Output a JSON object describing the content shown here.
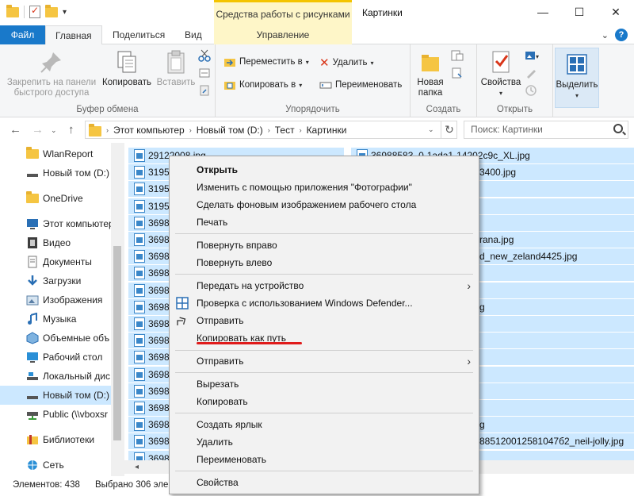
{
  "window": {
    "title": "Картинки",
    "contextual_tab_title": "Средства работы с рисунками",
    "minimize": "—",
    "maximize": "☐",
    "close": "✕"
  },
  "ribbon_tabs": {
    "file": "Файл",
    "home": "Главная",
    "share": "Поделиться",
    "view": "Вид",
    "manage": "Управление"
  },
  "ribbon": {
    "clipboard": {
      "label": "Буфер обмена",
      "pin": "Закрепить на панели быстрого доступа",
      "copy": "Копировать",
      "paste": "Вставить"
    },
    "organize": {
      "label": "Упорядочить",
      "move_to": "Переместить в",
      "copy_to": "Копировать в",
      "delete": "Удалить",
      "rename": "Переименовать"
    },
    "create": {
      "label": "Создать",
      "new_folder": "Новая папка"
    },
    "open": {
      "label": "Открыть",
      "properties": "Свойства"
    },
    "select": {
      "label": "Выделить"
    }
  },
  "address": {
    "crumbs": [
      "Этот компьютер",
      "Новый том (D:)",
      "Тест",
      "Картинки"
    ],
    "search_placeholder": "Поиск: Картинки"
  },
  "nav": {
    "items": [
      {
        "label": "WlanReport",
        "icon": "folder-icon"
      },
      {
        "label": "Новый том (D:)",
        "icon": "drive-icon"
      },
      {
        "label": "OneDrive",
        "icon": "onedrive-folder-icon"
      },
      {
        "label": "Этот компьютер",
        "icon": "computer-icon"
      },
      {
        "label": "Видео",
        "icon": "video-icon"
      },
      {
        "label": "Документы",
        "icon": "documents-icon"
      },
      {
        "label": "Загрузки",
        "icon": "downloads-icon"
      },
      {
        "label": "Изображения",
        "icon": "pictures-icon"
      },
      {
        "label": "Музыка",
        "icon": "music-icon"
      },
      {
        "label": "Объемные объ",
        "icon": "3d-objects-icon"
      },
      {
        "label": "Рабочий стол",
        "icon": "desktop-icon"
      },
      {
        "label": "Локальный дис",
        "icon": "local-disk-icon"
      },
      {
        "label": "Новый том (D:)",
        "icon": "drive-icon"
      },
      {
        "label": "Public (\\\\vboxsr",
        "icon": "network-drive-icon"
      },
      {
        "label": "Библиотеки",
        "icon": "libraries-icon"
      },
      {
        "label": "Сеть",
        "icon": "network-icon"
      }
    ]
  },
  "files": {
    "left_column": [
      "29122008.jpg",
      "31955",
      "31955",
      "31955",
      "36985",
      "36986",
      "36986",
      "36986",
      "36986",
      "36986",
      "36986",
      "36986",
      "36986",
      "36986",
      "36987",
      "36987",
      "36987",
      "36987",
      "36988"
    ],
    "right_column": [
      "36988583_0-1ada1-14202c9c_XL.jpg",
      "3400.jpg",
      "",
      "",
      "",
      "rana.jpg",
      "d_new_zeland4425.jpg",
      "",
      "",
      "g",
      "",
      "",
      "",
      "",
      "",
      "",
      "g",
      "885120012581047б2_neil-jolly.jpg",
      ""
    ]
  },
  "status": {
    "count": "Элементов: 438",
    "selected": "Выбрано 306 эле"
  },
  "context_menu": {
    "open": "Открыть",
    "edit_photos": "Изменить с помощью приложения \"Фотографии\"",
    "set_background": "Сделать фоновым изображением рабочего стола",
    "print": "Печать",
    "rotate_right": "Повернуть вправо",
    "rotate_left": "Повернуть влево",
    "cast": "Передать на устройство",
    "defender": "Проверка с использованием Windows Defender...",
    "share": "Отправить",
    "copy_as_path": "Копировать как путь",
    "send_to": "Отправить",
    "cut": "Вырезать",
    "copy": "Копировать",
    "create_shortcut": "Создать ярлык",
    "delete": "Удалить",
    "rename": "Переименовать",
    "properties": "Свойства"
  }
}
